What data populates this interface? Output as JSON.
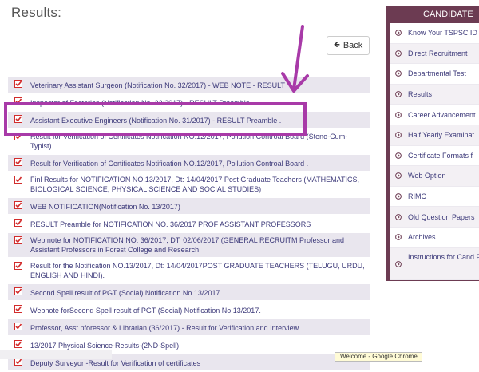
{
  "page_title": "Results:",
  "back_label": "Back",
  "results": [
    "Veterinary Assistant Surgeon (Notification No. 32/2017) - WEB NOTE - RESULT",
    "Inspector of Factories (Notification No. 33/2017) - RESULT Preamble .",
    "Assistant Executive Engineers (Notification No. 31/2017) - RESULT Preamble .",
    "Result for Verification of Certificates Notification NO.12/2017, Pollution Controal Board (Steno-Cum-Typist).",
    "Result for Verification of Certificates Notification NO.12/2017, Pollution Controal Board .",
    "Finl Results for NOTIFICATION NO.13/2017, Dt: 14/04/2017 Post Graduate Teachers (MATHEMATICS, BIOLOGICAL SCIENCE, PHYSICAL SCIENCE AND SOCIAL STUDIES)",
    "WEB NOTIFICATION(Notification No. 13/2017)",
    "RESULT Preamble for NOTIFICATION NO. 36/2017 PROF ASSISTANT PROFESSORS",
    "Web note for NOTIFICATION NO. 36/2017, DT. 02/06/2017 (GENERAL RECRUITM Professor and Assistant Professors in Forest College and Research",
    "Result for the Notification NO.13/2017, Dt: 14/04/2017POST GRADUATE TEACHERS (TELUGU, URDU, ENGLISH AND HINDI).",
    "Second Spell result of PGT (Social) Notification No.13/2017.",
    "Webnote forSecond Spell result of PGT (Social) Notification No.13/2017.",
    "Professor, Asst.pforessor & Librarian (36/2017) - Result for Verification and Interview.",
    "13/2017 Physical Science-Results-(2ND-Spell)",
    "Deputy Surveyor -Result for Verification of certificates"
  ],
  "sidebar": {
    "heading": "CANDIDATE",
    "items": [
      "Know Your TSPSC ID",
      "Direct Recruitment",
      "Departmental Test",
      "Results",
      "Career Advancement",
      "Half Yearly Examinat",
      "Certificate Formats f",
      "Web Option",
      "RIMC",
      "Old Question Papers",
      "Archives",
      "Instructions for Cand P"
    ]
  },
  "tooltip": "Welcome - Google Chrome",
  "colors": {
    "accent_maroon": "#6c3b52",
    "highlight": "#a83aa8",
    "check_red": "#d22c2c",
    "link_text": "#3d3a7a"
  }
}
